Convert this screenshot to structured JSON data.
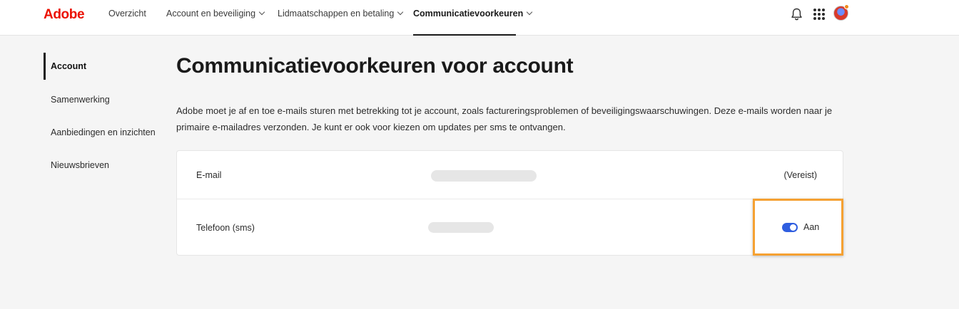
{
  "header": {
    "logo": "Adobe",
    "nav": [
      {
        "label": "Overzicht"
      },
      {
        "label": "Account en beveiliging"
      },
      {
        "label": "Lidmaatschappen en betaling"
      },
      {
        "label": "Communicatievoorkeuren"
      }
    ],
    "active_nav": "Communicatievoorkeuren",
    "icons": [
      "bell-icon",
      "apps-grid-icon",
      "avatar"
    ]
  },
  "sidebar": {
    "items": [
      {
        "label": "Account"
      },
      {
        "label": "Samenwerking"
      },
      {
        "label": "Aanbiedingen en inzichten"
      },
      {
        "label": "Nieuwsbrieven"
      }
    ],
    "active": "Account"
  },
  "main": {
    "title": "Communicatievoorkeuren voor account",
    "intro": "Adobe moet je af en toe e-mails sturen met betrekking tot je account, zoals factureringsproblemen of beveiligingswaarschuwingen. Deze e-mails worden naar je primaire e-mailadres verzonden. Je kunt er ook voor kiezen om updates per sms te ontvangen.",
    "rows": [
      {
        "label": "E-mail",
        "status": "(Vereist)"
      },
      {
        "label": "Telefoon (sms)",
        "toggle_label": "Aan",
        "toggle_on": true
      }
    ]
  },
  "colors": {
    "brand": "#eb1000",
    "toggle_on": "#2f5ee0",
    "highlight": "#f5a132"
  }
}
